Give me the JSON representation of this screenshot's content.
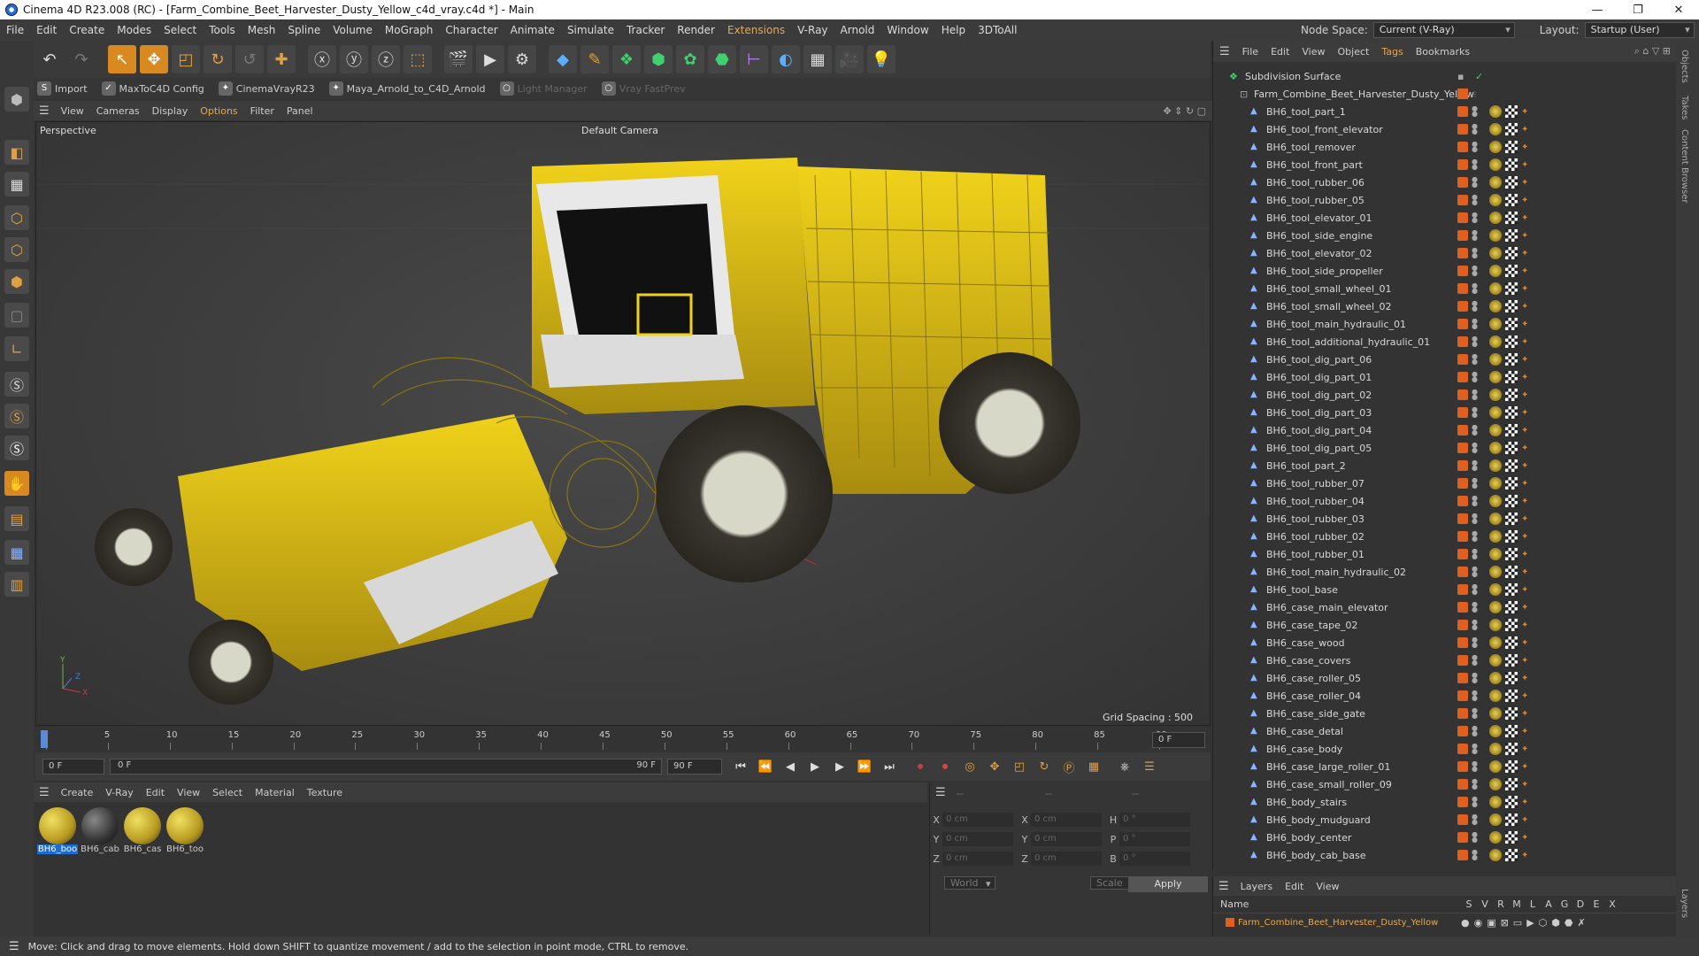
{
  "window": {
    "title": "Cinema 4D R23.008 (RC) - [Farm_Combine_Beet_Harvester_Dusty_Yellow_c4d_vray.c4d *] - Main"
  },
  "menu": [
    "File",
    "Edit",
    "Create",
    "Modes",
    "Select",
    "Tools",
    "Mesh",
    "Spline",
    "Volume",
    "MoGraph",
    "Character",
    "Animate",
    "Simulate",
    "Tracker",
    "Render",
    "Extensions",
    "V-Ray",
    "Arnold",
    "Window",
    "Help",
    "3DToAll"
  ],
  "nodespace": {
    "label": "Node Space:",
    "value": "Current (V-Ray)",
    "layout_label": "Layout:",
    "layout_value": "Startup (User)"
  },
  "plugins": [
    {
      "label": "Import",
      "enabled": true
    },
    {
      "label": "MaxToC4D Config",
      "enabled": true
    },
    {
      "label": "CinemaVrayR23",
      "enabled": true
    },
    {
      "label": "Maya_Arnold_to_C4D_Arnold",
      "enabled": true
    },
    {
      "label": "Light Manager",
      "enabled": false
    },
    {
      "label": "Vray FastPrev",
      "enabled": false
    }
  ],
  "viewport_menu": [
    "View",
    "Cameras",
    "Display",
    "Options",
    "Filter",
    "Panel"
  ],
  "viewport": {
    "name": "Perspective",
    "camera": "Default Camera",
    "grid_spacing": "Grid Spacing : 500 cm",
    "axis_y": "Y",
    "axis_x": "X",
    "axis_z": "Z"
  },
  "timeline": {
    "ticks": [
      "0",
      "5",
      "10",
      "15",
      "20",
      "25",
      "30",
      "35",
      "40",
      "45",
      "50",
      "55",
      "60",
      "65",
      "70",
      "75",
      "80",
      "85",
      "90"
    ],
    "frame_field": "0 F"
  },
  "transport": {
    "start": "0 F",
    "current": "0 F",
    "end": "90 F",
    "end2": "90 F"
  },
  "mat_menu": [
    "Create",
    "V-Ray",
    "Edit",
    "View",
    "Select",
    "Material",
    "Texture"
  ],
  "materials": [
    "BH6_boo",
    "BH6_cab",
    "BH6_cas",
    "BH6_too"
  ],
  "coords": {
    "rows": [
      {
        "a": "X",
        "av": "0 cm",
        "b": "X",
        "bv": "0 cm",
        "c": "H",
        "cv": "0 °"
      },
      {
        "a": "Y",
        "av": "0 cm",
        "b": "Y",
        "bv": "0 cm",
        "c": "P",
        "cv": "0 °"
      },
      {
        "a": "Z",
        "av": "0 cm",
        "b": "Z",
        "bv": "0 cm",
        "c": "B",
        "cv": "0 °"
      }
    ],
    "dash1": "--",
    "dash2": "--",
    "dash3": "--",
    "world": "World",
    "scale": "Scale",
    "apply": "Apply"
  },
  "obj_menu": [
    "File",
    "Edit",
    "View",
    "Object",
    "Tags",
    "Bookmarks"
  ],
  "objects": {
    "root": "Subdivision Surface",
    "group": "Farm_Combine_Beet_Harvester_Dusty_Yellow",
    "items": [
      "BH6_tool_part_1",
      "BH6_tool_front_elevator",
      "BH6_tool_remover",
      "BH6_tool_front_part",
      "BH6_tool_rubber_06",
      "BH6_tool_rubber_05",
      "BH6_tool_elevator_01",
      "BH6_tool_side_engine",
      "BH6_tool_elevator_02",
      "BH6_tool_side_propeller",
      "BH6_tool_small_wheel_01",
      "BH6_tool_small_wheel_02",
      "BH6_tool_main_hydraulic_01",
      "BH6_tool_additional_hydraulic_01",
      "BH6_tool_dig_part_06",
      "BH6_tool_dig_part_01",
      "BH6_tool_dig_part_02",
      "BH6_tool_dig_part_03",
      "BH6_tool_dig_part_04",
      "BH6_tool_dig_part_05",
      "BH6_tool_part_2",
      "BH6_tool_rubber_07",
      "BH6_tool_rubber_04",
      "BH6_tool_rubber_03",
      "BH6_tool_rubber_02",
      "BH6_tool_rubber_01",
      "BH6_tool_main_hydraulic_02",
      "BH6_tool_base",
      "BH6_case_main_elevator",
      "BH6_case_tape_02",
      "BH6_case_wood",
      "BH6_case_covers",
      "BH6_case_roller_05",
      "BH6_case_roller_04",
      "BH6_case_side_gate",
      "BH6_case_detal",
      "BH6_case_body",
      "BH6_case_large_roller_01",
      "BH6_case_small_roller_09",
      "BH6_body_stairs",
      "BH6_body_mudguard",
      "BH6_body_center",
      "BH6_body_cab_base"
    ]
  },
  "layers": {
    "menu": [
      "Layers",
      "Edit",
      "View"
    ],
    "col_name": "Name",
    "cols": [
      "S",
      "V",
      "R",
      "M",
      "L",
      "A",
      "G",
      "D",
      "E",
      "X"
    ],
    "row": "Farm_Combine_Beet_Harvester_Dusty_Yellow"
  },
  "right_tabs": [
    "Objects",
    "Takes",
    "Content Browser",
    "Layers"
  ],
  "status": "Move: Click and drag to move elements. Hold down SHIFT to quantize movement / add to the selection in point mode, CTRL to remove.",
  "colors": {
    "accent": "#e8a84a",
    "selection": "#1e6bd6",
    "layer": "#e06020",
    "machine": "#e6c619"
  }
}
